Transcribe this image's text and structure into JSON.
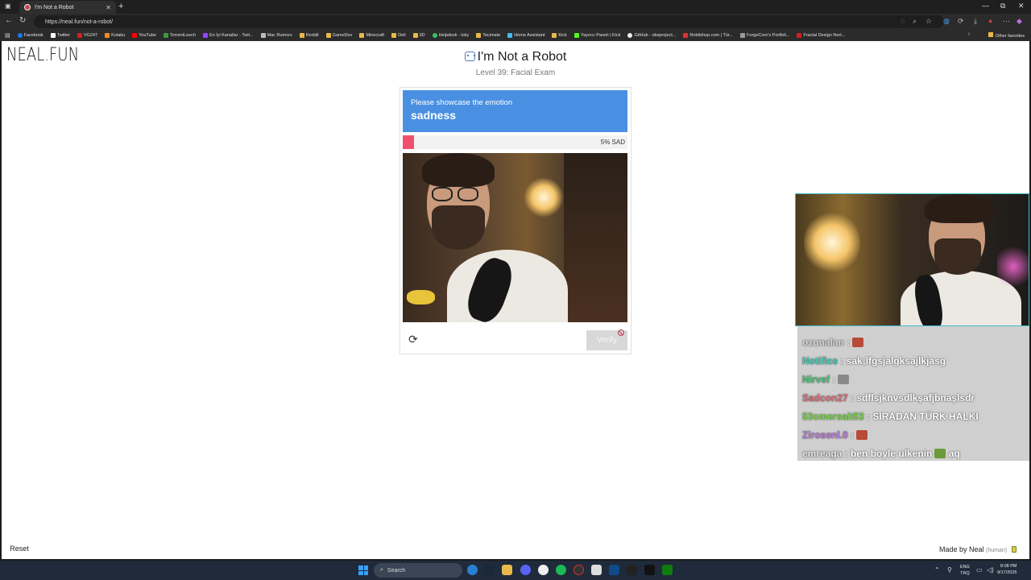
{
  "browser": {
    "tab_title": "I'm Not a Robot",
    "new_tab": "+",
    "url": "https://neal.fun/not-a-robot/",
    "bookmarks": [
      "Facebook",
      "Twitter",
      "VG247",
      "Kotaku",
      "YouTube",
      "TorrentLeech",
      "En İyi Kanallar - Twit...",
      "Mac Rumors",
      "Reddit",
      "GameDev",
      "Minecraft",
      "Dell",
      "3D",
      "Helpdesk - loky",
      "Tecimate",
      "Home Assistant",
      "Kick",
      "Yayıncı Paneli | Kick",
      "GitHub - obsproject...",
      "Robitshop.com | Tür...",
      "ForgeCore's Portfoli...",
      "Fractal Design Nort..."
    ],
    "other_favorites": "Other favorites"
  },
  "page": {
    "logo": "NEAL.FUN",
    "title": "I'm Not a Robot",
    "subtitle": "Level 39: Facial Exam",
    "prompt_label": "Please showcase the emotion",
    "emotion": "sadness",
    "meter_percent": 5,
    "meter_text": "5% SAD",
    "verify_label": "Verify",
    "reset_label": "Reset",
    "madeby_label": "Made by Neal",
    "madeby_tag": "(human)"
  },
  "chat": [
    {
      "user": "ozunalan",
      "sep": " :",
      "msg": "",
      "color": "#d9d9d9",
      "emote": "#b84a3a"
    },
    {
      "user": "Notifice",
      "sep": " :",
      "msg": " sak;lfgsjalgksajlkjasg",
      "color": "#3fd1b8",
      "emote": ""
    },
    {
      "user": "Nirvef",
      "sep": " :",
      "msg": "",
      "color": "#4ac878",
      "emote": "#8a8a8a"
    },
    {
      "user": "Sadcon27",
      "sep": " :",
      "msg": " sdflsjknvsdlkşafjbnaşlsdr",
      "color": "#d9707a",
      "emote": ""
    },
    {
      "user": "53omersait53",
      "sep": " :",
      "msg": " SIRADAN TÜRK HALKI",
      "color": "#7ad94a",
      "emote": ""
    },
    {
      "user": "Zirosenl.0",
      "sep": " :",
      "msg": "",
      "color": "#b77ad9",
      "emote": "#b84a3a"
    },
    {
      "user": "emreaga",
      "sep": " :",
      "msg": " ben boyle ulkenin",
      "color": "#e6e6e6",
      "emote": "#6a9a3a",
      "tail": " aq"
    }
  ],
  "taskbar": {
    "search": "Search",
    "lang_top": "ENG",
    "lang_bottom": "TRQ",
    "time": "8:08 PM",
    "date": "9/17/2025"
  },
  "colors": {
    "prompt_bg": "#4a90e2",
    "meter_fill": "#f0506e",
    "overlay_border": "#3fb9c8"
  }
}
